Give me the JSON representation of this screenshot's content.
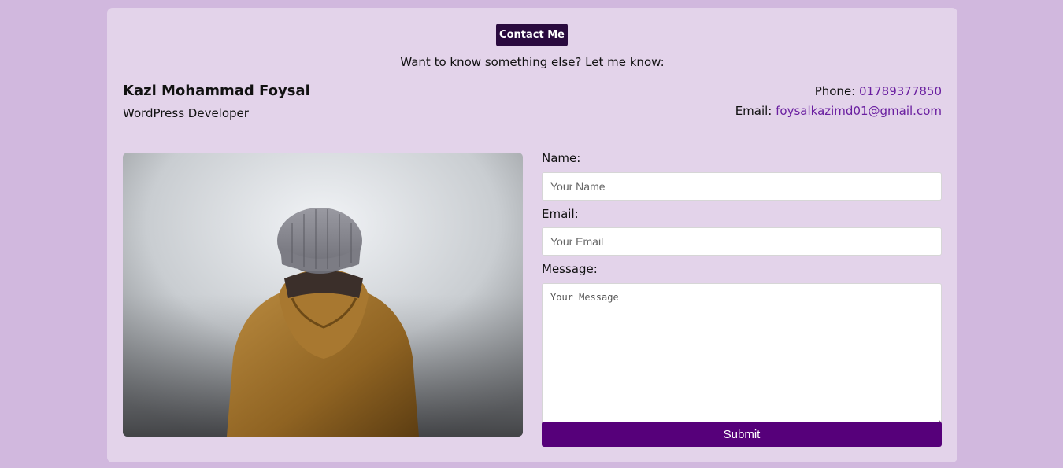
{
  "header": {
    "badge_label": "Contact Me",
    "subtitle": "Want to know something else? Let me know:"
  },
  "profile": {
    "name": "Kazi Mohammad Foysal",
    "role": "WordPress Developer",
    "phone_label": "Phone:",
    "phone_value": "01789377850",
    "email_label": "Email:",
    "email_value": "foysalkazimd01@gmail.com"
  },
  "form": {
    "name_label": "Name:",
    "name_placeholder": "Your Name",
    "email_label": "Email:",
    "email_placeholder": "Your Email",
    "message_label": "Message:",
    "message_placeholder": "Your Message",
    "submit_label": "Submit"
  },
  "colors": {
    "page_background": "#d1b8de",
    "card_background": "#e3d3ea",
    "badge_background": "#2a0a3f",
    "link": "#6a1fa0",
    "submit_background": "#56007a"
  },
  "image": {
    "icon": "photo-person-in-beanie-and-jacket"
  }
}
